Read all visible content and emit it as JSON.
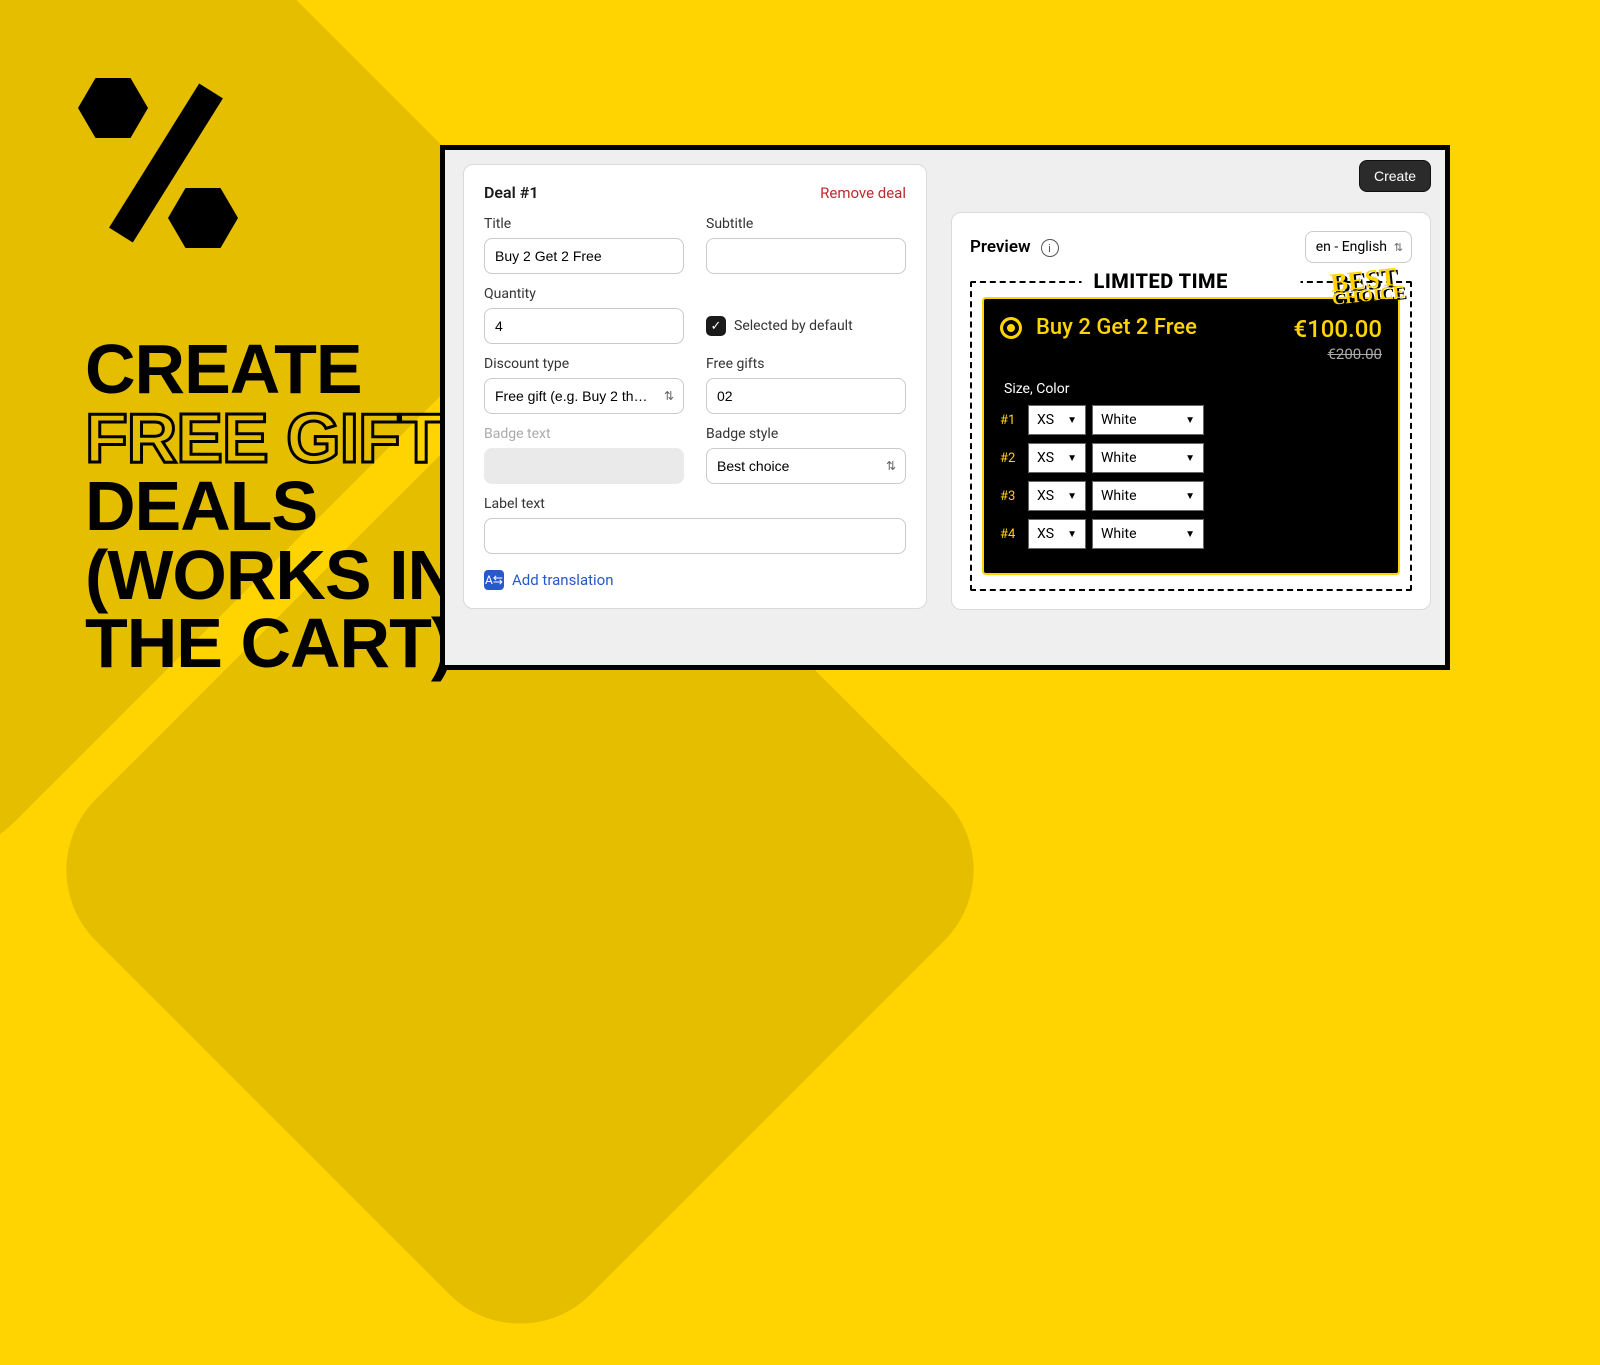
{
  "headline": {
    "l1": "CREATE",
    "l2": "FREE GIFT",
    "l3": "DEALS",
    "l4": "(WORKS IN",
    "l5": "THE CART)"
  },
  "form": {
    "header": "Deal #1",
    "remove": "Remove deal",
    "labels": {
      "title": "Title",
      "subtitle": "Subtitle",
      "quantity": "Quantity",
      "selected": "Selected by default",
      "discount": "Discount type",
      "freegifts": "Free gifts",
      "badgetext": "Badge text",
      "badgestyle": "Badge style",
      "labeltext": "Label text"
    },
    "values": {
      "title": "Buy 2 Get 2 Free",
      "subtitle": "",
      "quantity": "4",
      "discount": "Free gift (e.g. Buy 2 th…",
      "freegifts": "02",
      "badgetext": "",
      "badgestyle": "Best choice",
      "labeltext": ""
    },
    "addtrans": "Add translation"
  },
  "right": {
    "create": "Create",
    "preview": "Preview",
    "lang": "en - English",
    "offer_header": "LIMITED TIME OFFER",
    "best_badge_l1": "BEST",
    "best_badge_l2": "CHOICE",
    "deal_title": "Buy 2 Get 2 Free",
    "price": "€100.00",
    "old_price": "€200.00",
    "variant_label": "Size, Color",
    "rows": [
      {
        "num": "#1",
        "size": "XS",
        "color": "White"
      },
      {
        "num": "#2",
        "size": "XS",
        "color": "White"
      },
      {
        "num": "#3",
        "size": "XS",
        "color": "White"
      },
      {
        "num": "#4",
        "size": "XS",
        "color": "White"
      }
    ]
  }
}
